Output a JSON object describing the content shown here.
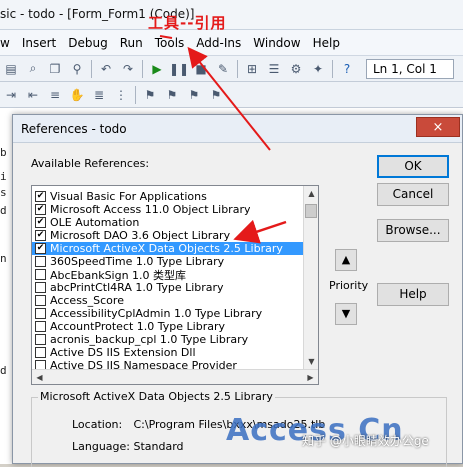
{
  "window": {
    "title": "sic - todo - [Form_Form1 (Code)]"
  },
  "menu": [
    "w",
    "Insert",
    "Debug",
    "Run",
    "Tools",
    "Add-Ins",
    "Window",
    "Help"
  ],
  "toolbar": {
    "line_col": "Ln 1, Col 1"
  },
  "annotation": {
    "text": "工具--引用",
    "color": "#e41a1a"
  },
  "code_fragments": [
    "b",
    "i",
    "s",
    "d",
    "n",
    "d"
  ],
  "dialog": {
    "title": "References - todo",
    "close_icon": "×",
    "available_label": "Available References:",
    "references": [
      {
        "label": "Visual Basic For Applications",
        "checked": true,
        "selected": false
      },
      {
        "label": "Microsoft Access 11.0 Object Library",
        "checked": true,
        "selected": false
      },
      {
        "label": "OLE Automation",
        "checked": true,
        "selected": false
      },
      {
        "label": "Microsoft DAO 3.6 Object Library",
        "checked": true,
        "selected": false
      },
      {
        "label": "Microsoft ActiveX Data Objects 2.5 Library",
        "checked": true,
        "selected": true
      },
      {
        "label": "360SpeedTime 1.0 Type Library",
        "checked": false,
        "selected": false
      },
      {
        "label": "AbcEbankSign 1.0 类型库",
        "checked": false,
        "selected": false
      },
      {
        "label": "abcPrintCtl4RA 1.0 Type Library",
        "checked": false,
        "selected": false
      },
      {
        "label": "Access_Score",
        "checked": false,
        "selected": false
      },
      {
        "label": "AccessibilityCplAdmin 1.0 Type Library",
        "checked": false,
        "selected": false
      },
      {
        "label": "AccountProtect 1.0 Type Library",
        "checked": false,
        "selected": false
      },
      {
        "label": "acronis_backup_cpl 1.0 Type Library",
        "checked": false,
        "selected": false
      },
      {
        "label": "Active DS IIS Extension Dll",
        "checked": false,
        "selected": false
      },
      {
        "label": "Active DS IIS Namespace Provider",
        "checked": false,
        "selected": false
      }
    ],
    "buttons": {
      "ok": "OK",
      "cancel": "Cancel",
      "browse": "Browse...",
      "help": "Help"
    },
    "priority_label": "Priority",
    "info": {
      "group_title": "Microsoft ActiveX Data Objects 2.5 Library",
      "location_label": "Location:",
      "location_value": "C:\\Program Files\\bxxx\\msado25.tlb",
      "language_label": "Language:",
      "language_value": "Standard"
    }
  },
  "watermark": {
    "text": "Access Cn",
    "zhihu": "知乎 @小眼睛效办公ge"
  }
}
